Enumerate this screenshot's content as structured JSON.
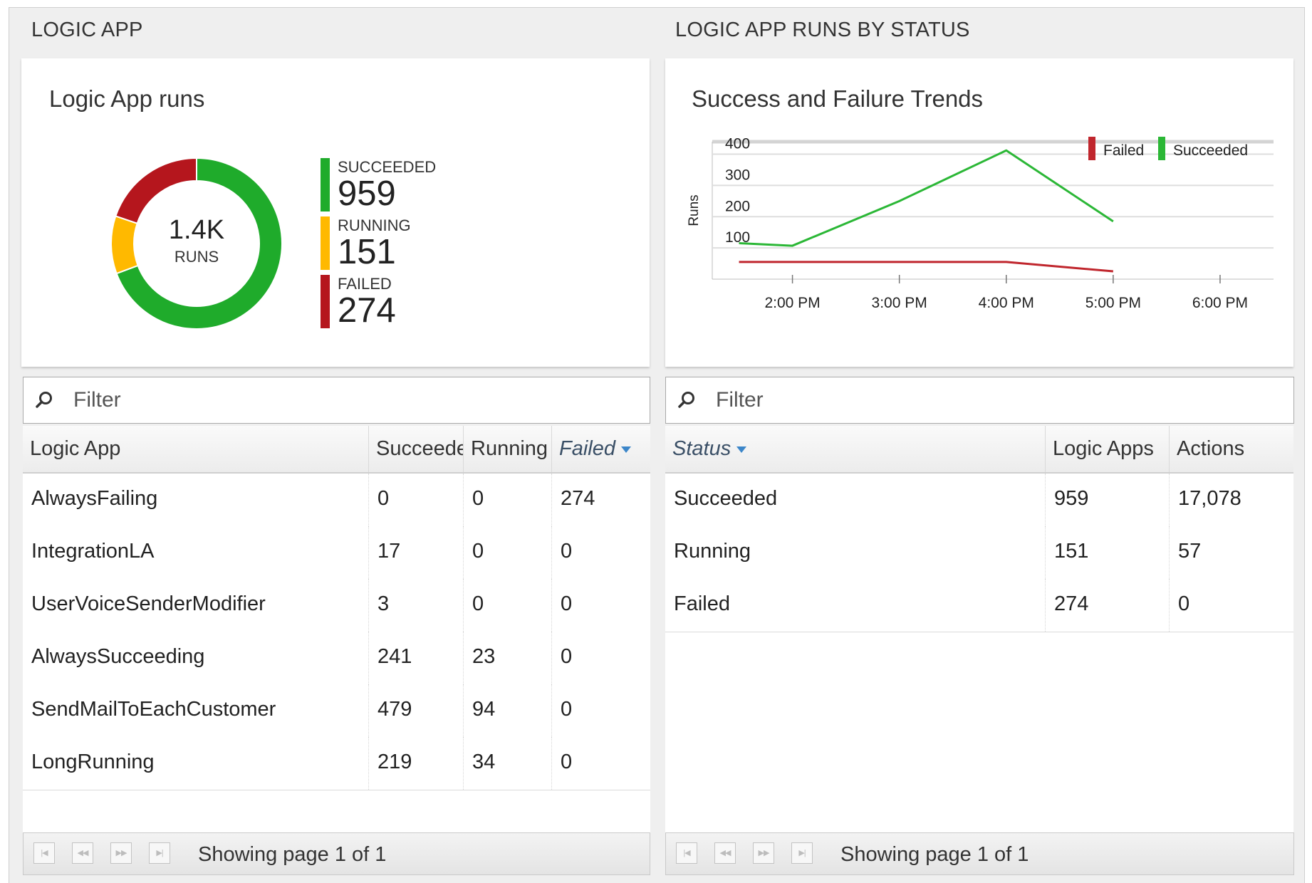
{
  "left_section": {
    "title": "LOGIC APP",
    "card_title": "Logic App runs",
    "donut": {
      "center_value": "1.4K",
      "center_label": "RUNS",
      "segments": [
        {
          "label": "SUCCEEDED",
          "value": 959,
          "color": "#1fab2b"
        },
        {
          "label": "RUNNING",
          "value": 151,
          "color": "#ffb900"
        },
        {
          "label": "FAILED",
          "value": 274,
          "color": "#b5161d"
        }
      ],
      "legend": [
        {
          "label": "SUCCEEDED",
          "value": "959"
        },
        {
          "label": "RUNNING",
          "value": "151"
        },
        {
          "label": "FAILED",
          "value": "274"
        }
      ]
    },
    "filter_placeholder": "Filter",
    "table": {
      "columns": [
        "Logic App",
        "Succeede",
        "Running",
        "Failed"
      ],
      "sorted_column": "Failed",
      "rows": [
        [
          "AlwaysFailing",
          "0",
          "0",
          "274"
        ],
        [
          "IntegrationLA",
          "17",
          "0",
          "0"
        ],
        [
          "UserVoiceSenderModifier",
          "3",
          "0",
          "0"
        ],
        [
          "AlwaysSucceeding",
          "241",
          "23",
          "0"
        ],
        [
          "SendMailToEachCustomer",
          "479",
          "94",
          "0"
        ],
        [
          "LongRunning",
          "219",
          "34",
          "0"
        ]
      ]
    },
    "pager_text": "Showing page 1 of 1"
  },
  "right_section": {
    "title": "LOGIC APP RUNS BY STATUS",
    "card_title": "Success and Failure Trends",
    "filter_placeholder": "Filter",
    "table": {
      "columns": [
        "Status",
        "Logic Apps",
        "Actions"
      ],
      "sorted_column": "Status",
      "rows": [
        [
          "Succeeded",
          "959",
          "17,078"
        ],
        [
          "Running",
          "151",
          "57"
        ],
        [
          "Failed",
          "274",
          "0"
        ]
      ]
    },
    "pager_text": "Showing page 1 of 1"
  },
  "pager_icons": [
    "first-page-icon",
    "previous-page-icon",
    "next-page-icon",
    "last-page-icon"
  ],
  "chart_data": {
    "type": "line",
    "title": "Success and Failure Trends",
    "ylabel": "Runs",
    "xlabel": "",
    "yticks": [
      100,
      200,
      300,
      400
    ],
    "ylim": [
      0,
      440
    ],
    "xticks": [
      "2:00 PM",
      "3:00 PM",
      "4:00 PM",
      "5:00 PM",
      "6:00 PM"
    ],
    "xlim_hours": [
      13.25,
      18.5
    ],
    "grid": true,
    "legend_position": "top-right",
    "series": [
      {
        "name": "Failed",
        "color": "#c0262d",
        "x": [
          13.5,
          14.0,
          15.0,
          16.0,
          17.0
        ],
        "y": [
          55,
          55,
          55,
          55,
          25
        ]
      },
      {
        "name": "Succeeded",
        "color": "#2bb736",
        "x": [
          13.5,
          14.0,
          15.0,
          16.0,
          17.0
        ],
        "y": [
          115,
          107,
          250,
          412,
          185
        ]
      }
    ]
  }
}
